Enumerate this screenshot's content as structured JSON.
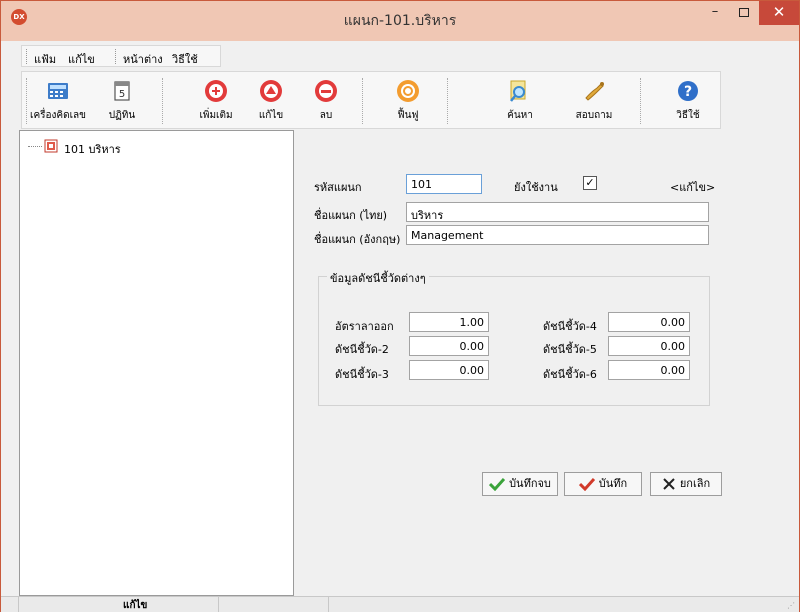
{
  "window": {
    "title": "แผนก-101.บริหาร",
    "logo_text": "DX",
    "minimize_label": "–",
    "close_label": "✕",
    "accent_color": "#f0c7b4",
    "close_color": "#c7493a"
  },
  "menu": {
    "items": [
      "แฟ้ม",
      "แก้ไข",
      "หน้าต่าง",
      "วิธีใช้"
    ]
  },
  "toolbar": {
    "buttons": [
      {
        "label": "เครื่องคิดเลข",
        "icon": "calculator-icon"
      },
      {
        "label": "ปฏิทิน",
        "icon": "calendar-icon"
      },
      {
        "label": "เพิ่มเติม",
        "icon": "add-circle-icon"
      },
      {
        "label": "แก้ไข",
        "icon": "edit-circle-icon"
      },
      {
        "label": "ลบ",
        "icon": "delete-circle-icon"
      },
      {
        "label": "ฟื้นฟู",
        "icon": "refresh-icon"
      },
      {
        "label": "ค้นหา",
        "icon": "search-icon"
      },
      {
        "label": "สอบถาม",
        "icon": "query-icon"
      },
      {
        "label": "วิธีใช้",
        "icon": "help-icon"
      }
    ]
  },
  "tree": {
    "root_label": "101 บริหาร"
  },
  "form": {
    "dept_code_label": "รหัสแผนก",
    "dept_code_value": "101",
    "active_label": "ยังใช้งาน",
    "active_checked": true,
    "mode_label": "<แก้ไข>",
    "name_th_label": "ชื่อแผนก (ไทย)",
    "name_th_value": "บริหาร",
    "name_en_label": "ชื่อแผนก (อังกฤษ)",
    "name_en_value": "Management",
    "group_title": "ข้อมูลดัชนีชี้วัดต่างๆ",
    "indicators_left": [
      {
        "label": "อัตราลาออก",
        "value": "1.00"
      },
      {
        "label": "ดัชนีชี้วัด-2",
        "value": "0.00"
      },
      {
        "label": "ดัชนีชี้วัด-3",
        "value": "0.00"
      }
    ],
    "indicators_right": [
      {
        "label": "ดัชนีชี้วัด-4",
        "value": "0.00"
      },
      {
        "label": "ดัชนีชี้วัด-5",
        "value": "0.00"
      },
      {
        "label": "ดัชนีชี้วัด-6",
        "value": "0.00"
      }
    ]
  },
  "buttons": {
    "save_close_label": "บันทึกจบ",
    "save_label": "บันทึก",
    "cancel_label": "ยกเลิก"
  },
  "status": {
    "mode_text": "แก้ไข"
  }
}
